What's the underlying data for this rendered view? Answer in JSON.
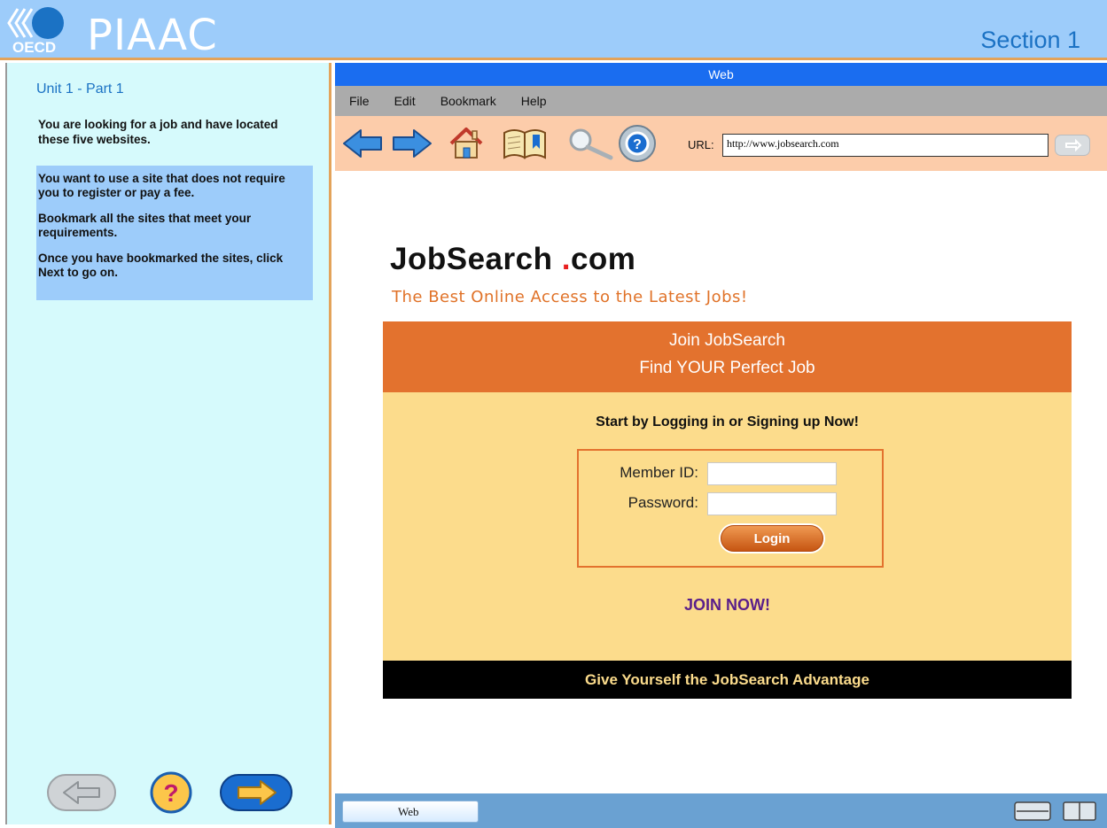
{
  "header": {
    "logo_text": "PIAAC",
    "oecd_text": "OECD",
    "section_title": "Section 1"
  },
  "left_panel": {
    "unit_title": "Unit 1 - Part 1",
    "intro": "You are looking for a job and have located these five websites.",
    "task": [
      "You want to use a site that does not require you to register or pay a fee.",
      "Bookmark all the sites that meet your requirements.",
      "Once you have bookmarked the sites, click Next to go on."
    ],
    "nav": {
      "back_icon": "arrow-left-icon",
      "help_icon": "question-mark-icon",
      "next_icon": "arrow-right-icon"
    }
  },
  "browser": {
    "title": "Web",
    "menu": [
      "File",
      "Edit",
      "Bookmark",
      "Help"
    ],
    "toolbar_icons": [
      "back-arrow-icon",
      "forward-arrow-icon",
      "home-icon",
      "bookmarks-book-icon",
      "search-magnifier-icon",
      "help-lifebuoy-icon"
    ],
    "url_label": "URL:",
    "url_value": "http://www.jobsearch.com"
  },
  "page": {
    "site_name_prefix": "JobSearch",
    "site_name_dot": ".",
    "site_name_suffix": "com",
    "tagline": "The Best Online Access to the Latest Jobs!",
    "banner_line1": "Join JobSearch",
    "banner_line2": "Find YOUR Perfect Job",
    "start_text": "Start by Logging in or Signing up Now!",
    "member_id_label": "Member ID:",
    "password_label": "Password:",
    "login_button": "Login",
    "join_now": "JOIN NOW!",
    "footer_bar": "Give Yourself the JobSearch Advantage"
  },
  "taskbar": {
    "tab_label": "Web"
  },
  "colors": {
    "header_bg": "#9dccfa",
    "left_panel_bg": "#d6fafc",
    "browser_title_bg": "#1a6df0",
    "toolbar_bg": "#fcccaa",
    "accent_orange": "#e3722e",
    "form_bg": "#fcdc8c",
    "join_purple": "#5a1f8a"
  }
}
